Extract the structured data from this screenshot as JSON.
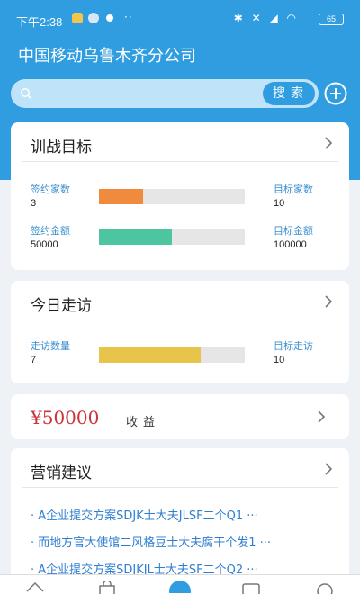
{
  "status_bar": {
    "time": "下午2:38",
    "battery": "65",
    "notification_icons": [
      "app-notification-icon",
      "app-notification-icon",
      "app-notification-icon"
    ],
    "system_icons": "bluetooth-icon, mute-icon, signal-icon, wifi-icon"
  },
  "header": {
    "company": "中国移动乌鲁木齐分公司",
    "search_placeholder": "",
    "search_button": "搜索"
  },
  "training_goals": {
    "title": "训战目标",
    "signed_count_label": "签约家数",
    "signed_count": "3",
    "target_count_label": "目标家数",
    "target_count": "10",
    "signed_count_progress": 0.3,
    "signed_amount_label": "签约金额",
    "signed_amount": "50000",
    "target_amount_label": "目标金额",
    "target_amount": "100000",
    "signed_amount_progress": 0.5,
    "colors": {
      "count_bar": "#f08a3c",
      "amount_bar": "#4dc5a0"
    }
  },
  "today_visits": {
    "title": "今日走访",
    "visit_count_label": "走访数量",
    "visit_count": "7",
    "target_visits_label": "目标走访",
    "target_visits": "10",
    "visit_progress": 0.7,
    "colors": {
      "visit_bar": "#e8c44a"
    }
  },
  "income": {
    "amount": "¥50000",
    "label": "收益"
  },
  "marketing": {
    "title": "营销建议",
    "items": [
      "· A企业提交方案SDJK士大夫JLSF二个Q1 ···",
      "· 而地方官大使馆二风格豆士大夫腐干个发1 ···",
      "· A企业提交方案SDJKJL士大夫SF二个Q2 ···"
    ]
  },
  "colors": {
    "primary": "#2f9de0",
    "accent_red": "#c8353a",
    "link_blue": "#2f7fd0"
  }
}
